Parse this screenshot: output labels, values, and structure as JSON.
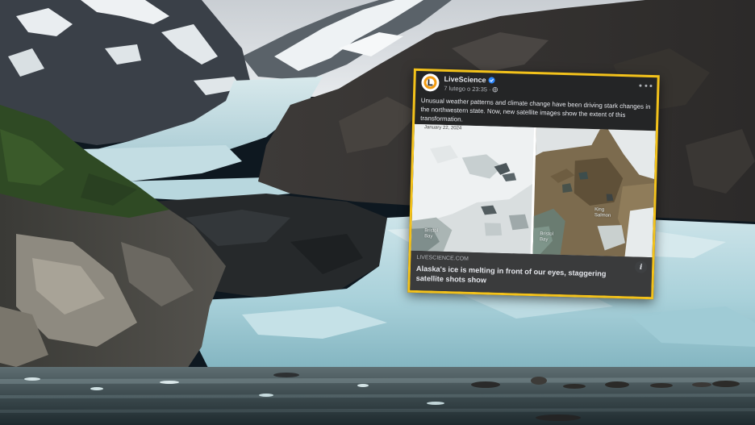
{
  "post": {
    "author": "LiveScience",
    "timestamp": "7 lutego o 23:35",
    "separator": "·",
    "text": "Unusual weather patterns and climate change have been driving stark changes in the northwestern state. Now, new satellite images show the extent of this transformation.",
    "image_date": "January 22, 2024",
    "image_labels": {
      "left_bay": "Bristol\nBay",
      "right_bay": "Bristol\nBay",
      "king_salmon": "King\nSalmon"
    },
    "link": {
      "domain": "LIVESCIENCE.COM",
      "title": "Alaska's ice is melting in front of our eyes, staggering satellite shots show",
      "info_label": "i"
    }
  },
  "colors": {
    "highlight_border": "#f3c21b",
    "card_background": "#242526",
    "link_background": "#3a3b3c",
    "verified_badge": "#2d88ff",
    "logo_orange": "#f39c12"
  },
  "icons": [
    "livescience-logo-icon",
    "verified-badge-icon",
    "globe-icon",
    "more-options-icon",
    "info-icon"
  ]
}
